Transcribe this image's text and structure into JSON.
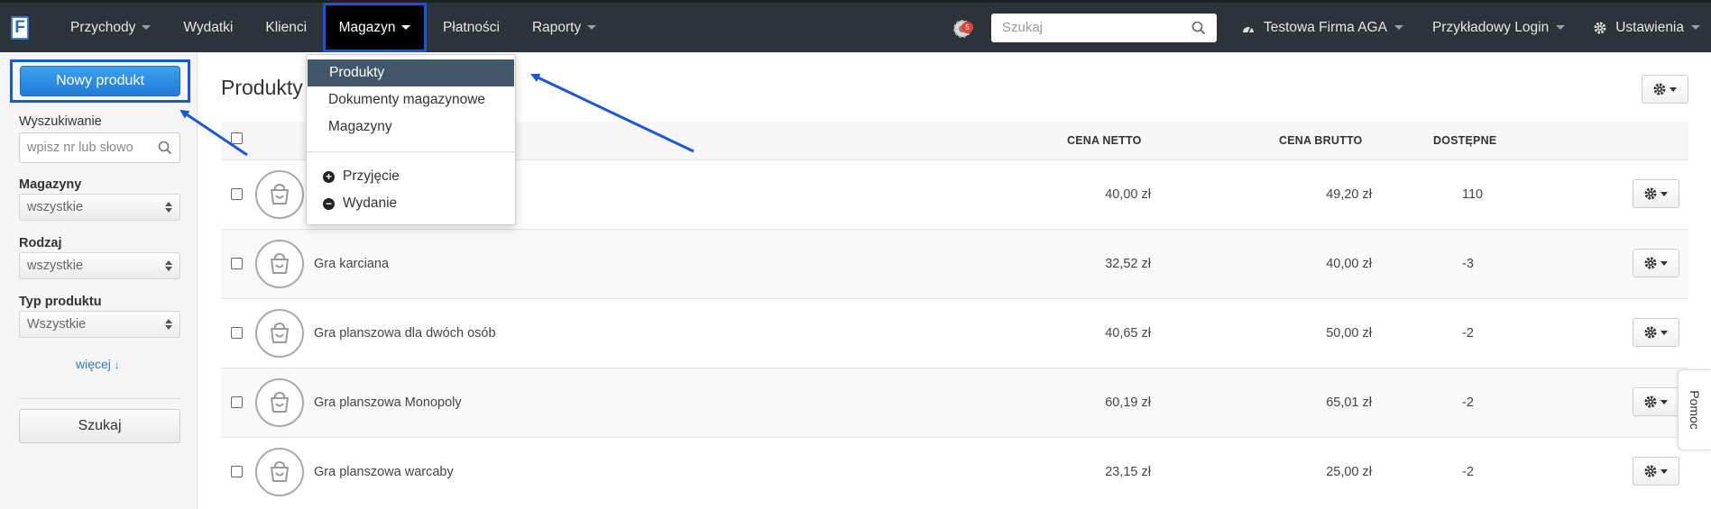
{
  "navbar": {
    "logo": "F",
    "items": [
      {
        "label": "Przychody",
        "has_caret": true
      },
      {
        "label": "Wydatki",
        "has_caret": false
      },
      {
        "label": "Klienci",
        "has_caret": false
      },
      {
        "label": "Magazyn",
        "has_caret": true,
        "active": true
      },
      {
        "label": "Płatności",
        "has_caret": false
      },
      {
        "label": "Raporty",
        "has_caret": true
      }
    ],
    "notification_count": "5",
    "search_placeholder": "Szukaj",
    "company": "Testowa Firma AGA",
    "login": "Przykładowy Login",
    "settings": "Ustawienia"
  },
  "dropdown": {
    "items": [
      "Produkty",
      "Dokumenty magazynowe",
      "Magazyny"
    ],
    "actions": [
      {
        "label": "Przyjęcie",
        "icon": "plus-circle-icon"
      },
      {
        "label": "Wydanie",
        "icon": "minus-circle-icon"
      }
    ]
  },
  "sidebar": {
    "new_button": "Nowy produkt",
    "search_label": "Wyszukiwanie",
    "search_placeholder": "wpisz nr lub słowo",
    "warehouses_label": "Magazyny",
    "warehouses_value": "wszystkie",
    "kind_label": "Rodzaj",
    "kind_value": "wszystkie",
    "type_label": "Typ produktu",
    "type_value": "Wszystkie",
    "more": "więcej",
    "search_button": "Szukaj"
  },
  "main": {
    "title": "Produkty",
    "columns": [
      "CENA NETTO",
      "CENA BRUTTO",
      "DOSTĘPNE"
    ],
    "rows": [
      {
        "name": "",
        "net": "40,00 zł",
        "gross": "49,20 zł",
        "available": "110"
      },
      {
        "name": "Gra karciana",
        "net": "32,52 zł",
        "gross": "40,00 zł",
        "available": "-3"
      },
      {
        "name": "Gra planszowa dla dwóch osób",
        "net": "40,65 zł",
        "gross": "50,00 zł",
        "available": "-2"
      },
      {
        "name": "Gra planszowa Monopoly",
        "net": "60,19 zł",
        "gross": "65,01 zł",
        "available": "-2"
      },
      {
        "name": "Gra planszowa warcaby",
        "net": "23,15 zł",
        "gross": "25,00 zł",
        "available": "-2"
      }
    ]
  },
  "help_tab": "Pomoc",
  "colors": {
    "accent": "#1a56db",
    "navbar": "#2d333b",
    "primary_button": "#2a8be6",
    "highlight": "#43576b"
  }
}
